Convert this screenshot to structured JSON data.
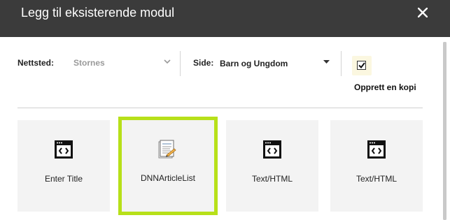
{
  "dialog": {
    "title": "Legg til eksisterende modul",
    "close_icon": "close-icon"
  },
  "toolbar": {
    "site_label": "Nettsted:",
    "site_value": "Stornes",
    "page_label": "Side:",
    "page_value": "Barn og Ungdom",
    "copy_label": "Opprett en kopi",
    "copy_checked": true
  },
  "modules": [
    {
      "label": "Enter Title",
      "icon": "html-module-icon",
      "selected": false
    },
    {
      "label": "DNNArticleList",
      "icon": "article-list-icon",
      "selected": true
    },
    {
      "label": "Text/HTML",
      "icon": "html-module-icon",
      "selected": false
    },
    {
      "label": "Text/HTML",
      "icon": "html-module-icon",
      "selected": false
    }
  ],
  "colors": {
    "titlebar": "#3b3b3b",
    "selected_border": "#b7e019",
    "tile_bg": "#f3f3f3"
  }
}
